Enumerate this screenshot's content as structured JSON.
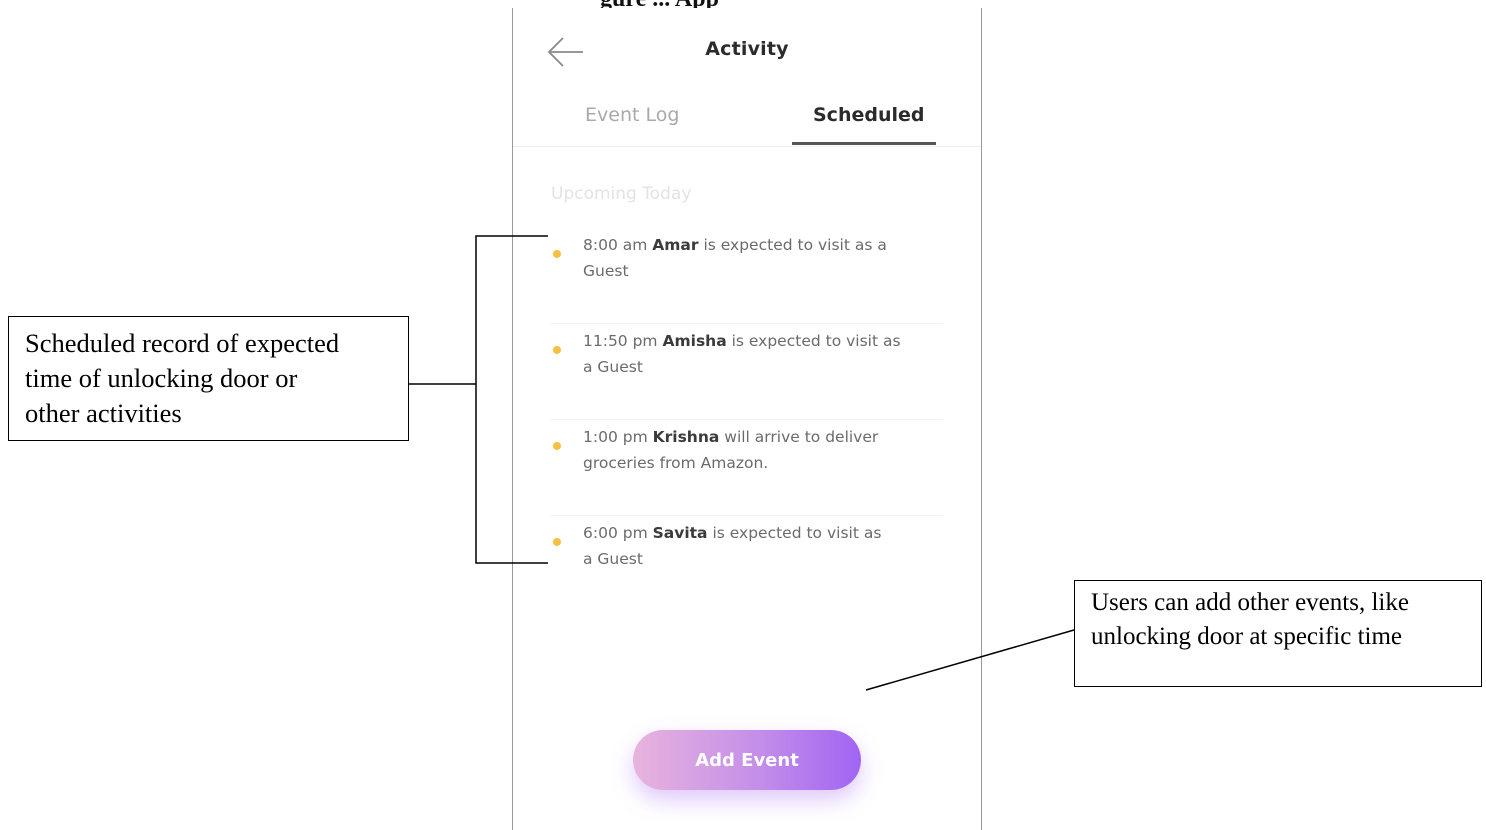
{
  "page": {
    "caption_partial": "gure ... App"
  },
  "app": {
    "title": "Activity",
    "back_icon": "arrow-left-icon"
  },
  "tabs": [
    {
      "label": "Event Log",
      "active": false
    },
    {
      "label": "Scheduled",
      "active": true
    }
  ],
  "section": {
    "label": "Upcoming Today"
  },
  "events": [
    {
      "time": "8:00 am",
      "name": "Amar",
      "rest_line1": " is expected to visit as a",
      "rest_line2": "Guest"
    },
    {
      "time": "11:50 pm",
      "name": "Amisha",
      "rest_line1": " is expected to visit as",
      "rest_line2": "a Guest"
    },
    {
      "time": "1:00 pm",
      "name": "Krishna",
      "rest_line1": " will arrive to deliver",
      "rest_line2": "groceries from Amazon."
    },
    {
      "time": "6:00 pm",
      "name": "Savita",
      "rest_line1": " is expected to visit as",
      "rest_line2": "a Guest"
    }
  ],
  "add_button": {
    "label": "Add Event"
  },
  "annotations": {
    "left": {
      "line1": "Scheduled record of expected",
      "line2": "time of unlocking door or",
      "line3": "other activities"
    },
    "right": {
      "line1": "Users can add other events, like",
      "line2": "unlocking door at specific time"
    }
  },
  "colors": {
    "dot": "#f6c142",
    "button_gradient_start": "#e8b4dd",
    "button_gradient_end": "#a064f3",
    "active_tab": "#2b2b2b",
    "inactive_tab": "#a9a9a9"
  }
}
